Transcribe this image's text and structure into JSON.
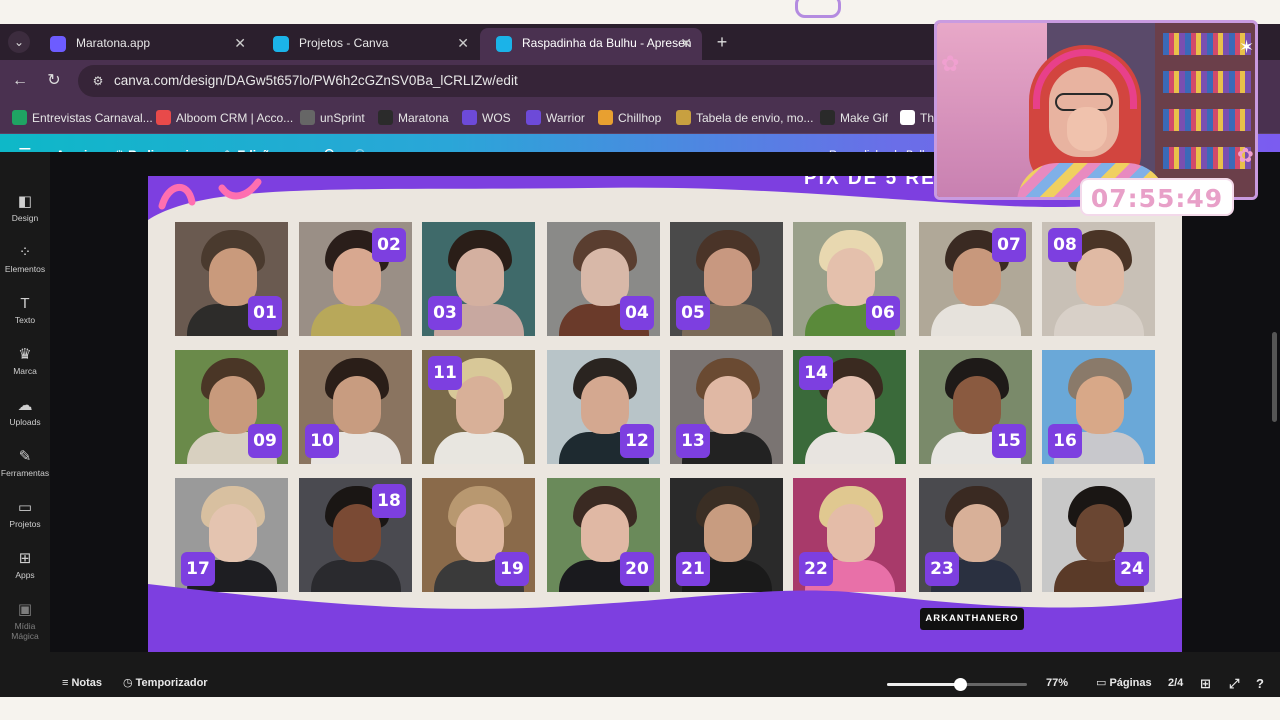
{
  "browser": {
    "tabs": [
      {
        "title": "Maratona.app",
        "fav_color": "#6d5cff",
        "active": false
      },
      {
        "title": "Projetos - Canva",
        "fav_color": "#1bb3e8",
        "active": false
      },
      {
        "title": "Raspadinha da Bulhu - Apresen",
        "fav_color": "#1bb3e8",
        "active": true
      }
    ],
    "new_tab_label": "+",
    "url": "canva.com/design/DAGw5t657lo/PW6h2cGZnSV0Ba_lCRLIZw/edit",
    "bookmarks": [
      {
        "label": "Entrevistas Carnaval...",
        "icon": "drive-icon",
        "color": "#1fa463"
      },
      {
        "label": "Alboom CRM | Acco...",
        "icon": "alboom-icon",
        "color": "#e84a4a"
      },
      {
        "label": "unSprint",
        "icon": "globe-icon",
        "color": "#666"
      },
      {
        "label": "Maratona",
        "icon": "maratona-icon",
        "color": "#2b2b2b"
      },
      {
        "label": "WOS",
        "icon": "w-icon",
        "color": "#6d4ad8"
      },
      {
        "label": "Warrior",
        "icon": "warrior-icon",
        "color": "#6d4ad8"
      },
      {
        "label": "Chillhop",
        "icon": "chillhop-icon",
        "color": "#e8a030"
      },
      {
        "label": "Tabela de envio, mo...",
        "icon": "smiley-icon",
        "color": "#c8a040"
      },
      {
        "label": "Make Gif",
        "icon": "makegif-icon",
        "color": "#2a2a2a"
      },
      {
        "label": "Th",
        "icon": "wikipedia-icon",
        "color": "#fff"
      }
    ]
  },
  "canva": {
    "menu": {
      "file": "Arquivo",
      "resize": "Redimensionar",
      "edit": "Edição"
    },
    "doc_title": "Raspadinha da Bulhu",
    "sidebar": [
      {
        "label": "Design",
        "icon": "design-icon",
        "glyph": "◧"
      },
      {
        "label": "Elementos",
        "icon": "elements-icon",
        "glyph": "⁘"
      },
      {
        "label": "Texto",
        "icon": "text-icon",
        "glyph": "T"
      },
      {
        "label": "Marca",
        "icon": "brand-icon",
        "glyph": "♛"
      },
      {
        "label": "Uploads",
        "icon": "upload-icon",
        "glyph": "☁"
      },
      {
        "label": "Ferramentas",
        "icon": "tools-icon",
        "glyph": "✎"
      },
      {
        "label": "Projetos",
        "icon": "folder-icon",
        "glyph": "▭"
      },
      {
        "label": "Apps",
        "icon": "apps-icon",
        "glyph": "⊞"
      },
      {
        "label": "Mídia Mágica",
        "icon": "magic-media-icon",
        "glyph": "▣"
      }
    ],
    "slide_title": "PIX DE 5 RE",
    "tooltip": "ARKANTHANERO",
    "bottom": {
      "notes": "Notas",
      "timer": "Temporizador",
      "zoom": "77%",
      "zoom_level": 0.52,
      "pages_label": "Páginas",
      "pages_count": "2/4"
    }
  },
  "grid": [
    {
      "num": "01",
      "badge": "br",
      "bg": "#6a5a50",
      "skin": "#c99a7c",
      "hair": "#4a3a2e",
      "body": "#2d2c2a"
    },
    {
      "num": "02",
      "badge": "tr",
      "bg": "#9a8f86",
      "skin": "#d8a890",
      "hair": "#2a1e1a",
      "body": "#b8a85a"
    },
    {
      "num": "03",
      "badge": "bl",
      "bg": "#3f6a6a",
      "skin": "#d4b0a0",
      "hair": "#2a1e18",
      "body": "#c8a8a0"
    },
    {
      "num": "04",
      "badge": "br",
      "bg": "#8a8a88",
      "skin": "#d8b8a8",
      "hair": "#5a3e30",
      "body": "#6a3a2a"
    },
    {
      "num": "05",
      "badge": "bl",
      "bg": "#4a4a4a",
      "skin": "#c89880",
      "hair": "#4a3428",
      "body": "#7a6a58"
    },
    {
      "num": "06",
      "badge": "br",
      "bg": "#9aa08a",
      "skin": "#e4c0ac",
      "hair": "#e8d8b0",
      "body": "#5a8a3a"
    },
    {
      "num": "07",
      "badge": "tr",
      "bg": "#b0a898",
      "skin": "#c8987c",
      "hair": "#3a2a22",
      "body": "#e6e2dc"
    },
    {
      "num": "08",
      "badge": "tl",
      "bg": "#c8c0b6",
      "skin": "#e0baa4",
      "hair": "#4a3426",
      "body": "#d8d0c8"
    },
    {
      "num": "09",
      "badge": "br",
      "bg": "#6a8a4a",
      "skin": "#c89a7c",
      "hair": "#4a3626",
      "body": "#d8d0c0"
    },
    {
      "num": "10",
      "badge": "bl",
      "bg": "#8a7460",
      "skin": "#c89c80",
      "hair": "#2a1e18",
      "body": "#e8e4e0"
    },
    {
      "num": "11",
      "badge": "tl",
      "bg": "#7a6a4a",
      "skin": "#d8b098",
      "hair": "#d8c898",
      "body": "#e8e6e0"
    },
    {
      "num": "12",
      "badge": "br",
      "bg": "#b8c4c8",
      "skin": "#d4a890",
      "hair": "#2a2420",
      "body": "#1e2a30"
    },
    {
      "num": "13",
      "badge": "bl",
      "bg": "#7a7472",
      "skin": "#e0b8a4",
      "hair": "#6a4a32",
      "body": "#222"
    },
    {
      "num": "14",
      "badge": "tl",
      "bg": "#3a6a3a",
      "skin": "#e4c0b0",
      "hair": "#3a2a20",
      "body": "#e8e4e0"
    },
    {
      "num": "15",
      "badge": "br",
      "bg": "#7a8a6a",
      "skin": "#8a5a40",
      "hair": "#1e1a18",
      "body": "#e8e6e2"
    },
    {
      "num": "16",
      "badge": "bl",
      "bg": "#6aa8d8",
      "skin": "#d8a888",
      "hair": "#8a7a6a",
      "body": "#c8c8cc"
    },
    {
      "num": "17",
      "badge": "bl",
      "bg": "#9a9a9a",
      "skin": "#e4c4b0",
      "hair": "#d8c0a0",
      "body": "#1e1e22"
    },
    {
      "num": "18",
      "badge": "tr",
      "bg": "#4a4a50",
      "skin": "#7a4a34",
      "hair": "#1a1614",
      "body": "#2a2a2e"
    },
    {
      "num": "19",
      "badge": "br",
      "bg": "#8a6a4a",
      "skin": "#e0b8a0",
      "hair": "#b89870",
      "body": "#3a3a3a"
    },
    {
      "num": "20",
      "badge": "br",
      "bg": "#6a8a5a",
      "skin": "#e0b8a4",
      "hair": "#3a2a22",
      "body": "#1a1a1e"
    },
    {
      "num": "21",
      "badge": "bl",
      "bg": "#2a2a2a",
      "skin": "#c89c80",
      "hair": "#3a2e24",
      "body": "#1a1a1a"
    },
    {
      "num": "22",
      "badge": "bl",
      "bg": "#a83a6a",
      "skin": "#e4bca8",
      "hair": "#e0c890",
      "body": "#e870a8"
    },
    {
      "num": "23",
      "badge": "bl",
      "bg": "#4a4a4e",
      "skin": "#d8b098",
      "hair": "#3a2a22",
      "body": "#2a3040"
    },
    {
      "num": "24",
      "badge": "br",
      "bg": "#c8c8c8",
      "skin": "#6a4632",
      "hair": "#1a1614",
      "body": "#5a3a28"
    }
  ],
  "overlay": {
    "timer": "07:55:49"
  }
}
